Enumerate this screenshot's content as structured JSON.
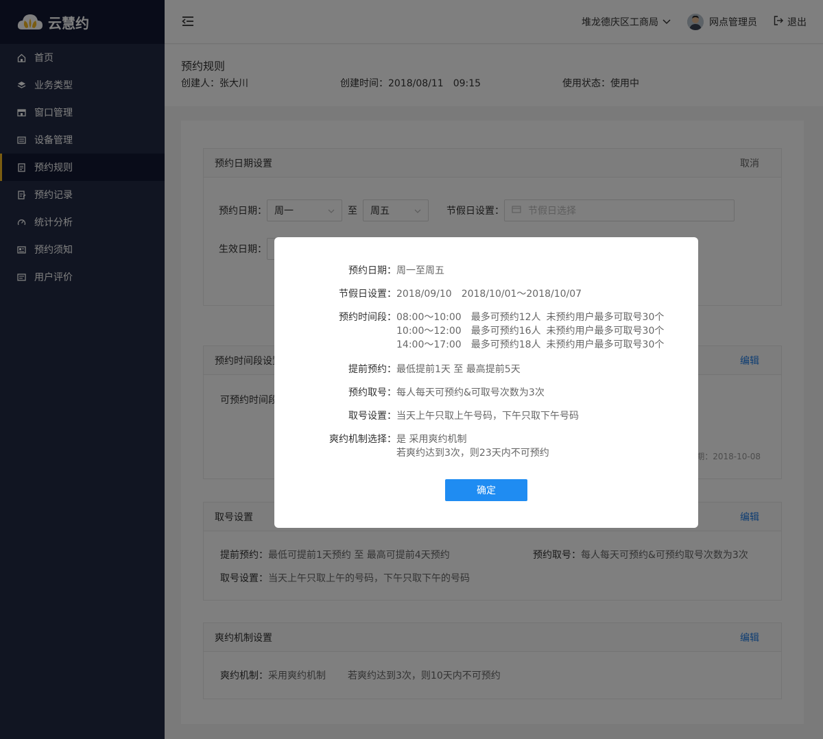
{
  "brand": {
    "name": "云慧约"
  },
  "sidebar": {
    "items": [
      {
        "label": "首页",
        "icon": "home-icon"
      },
      {
        "label": "业务类型",
        "icon": "layers-icon"
      },
      {
        "label": "窗口管理",
        "icon": "window-icon"
      },
      {
        "label": "设备管理",
        "icon": "device-icon"
      },
      {
        "label": "预约规则",
        "icon": "document-icon",
        "active": true
      },
      {
        "label": "预约记录",
        "icon": "record-icon"
      },
      {
        "label": "统计分析",
        "icon": "gauge-icon"
      },
      {
        "label": "预约须知",
        "icon": "notice-icon"
      },
      {
        "label": "用户评价",
        "icon": "comment-icon"
      }
    ]
  },
  "topbar": {
    "org": "堆龙德庆区工商局",
    "user": "网点管理员",
    "logout": "退出"
  },
  "header": {
    "title": "预约规则",
    "creator_label": "创建人：",
    "creator": "张大川",
    "created_label": "创建时间：",
    "created_date": "2018/08/11",
    "created_time": "09:15",
    "status_label": "使用状态：",
    "status": "使用中"
  },
  "date_card": {
    "title": "预约日期设置",
    "cancel": "取消",
    "date_label": "预约日期：",
    "from": "周一",
    "to_sep": "至",
    "to": "周五",
    "holiday_label": "节假日设置：",
    "holiday_placeholder": "节假日选择",
    "effective_label": "生效日期："
  },
  "timeslot_card": {
    "title": "预约时间段设置",
    "edit": "编辑",
    "row_label": "可预约时间段",
    "date_note": "日期：2018-10-08"
  },
  "ticket_card": {
    "title": "取号设置",
    "edit": "编辑",
    "advance_label": "提前预约：",
    "advance": "最低可提前1天预约 至  最高可提前4天预约",
    "take_label": "预约取号：",
    "take": "每人每天可预约&可预约取号次数为3次",
    "rule_label": "取号设置：",
    "rule": "当天上午只取上午的号码，下午只取下午的号码"
  },
  "noshow_card": {
    "title": "爽约机制设置",
    "edit": "编辑",
    "label": "爽约机制：",
    "value": "采用爽约机制",
    "detail": "若爽约达到3次，则10天内不可预约"
  },
  "modal": {
    "date_label": "预约日期：",
    "date": "周一至周五",
    "holiday_label": "节假日设置：",
    "holiday_1": "2018/09/10",
    "holiday_2": "2018/10/01～2018/10/07",
    "slots_label": "预约时间段：",
    "slots": [
      {
        "time": "08:00～10:00",
        "max": "最多可预约12人",
        "limit": "未预约用户最多可取号30个"
      },
      {
        "time": "10:00～12:00",
        "max": "最多可预约16人",
        "limit": "未预约用户最多可取号30个"
      },
      {
        "time": "14:00～17:00",
        "max": "最多可预约18人",
        "limit": "未预约用户最多可取号30个"
      }
    ],
    "advance_label": "提前预约：",
    "advance": "最低提前1天 至 最高提前5天",
    "take_label": "预约取号：",
    "take": "每人每天可预约&可取号次数为3次",
    "rule_label": "取号设置：",
    "rule": "当天上午只取上午号码，下午只取下午号码",
    "noshow_label": "爽约机制选择：",
    "noshow_1": "是 采用爽约机制",
    "noshow_2": "若爽约达到3次，则23天内不可预约",
    "confirm": "确定"
  },
  "colors": {
    "sidebar": "#232b45",
    "sidebar_dark": "#121933",
    "accent": "#f5b922",
    "primary": "#1f8cf2",
    "link": "#1f7ce6"
  }
}
